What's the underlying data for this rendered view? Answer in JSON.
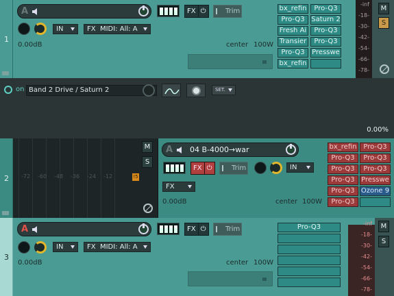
{
  "colors": {
    "track_bg": "#4a9b93",
    "meter_bg": "#221c1c",
    "fx_teal": "#2e8a84",
    "fx_red": "#9b3a3a",
    "accent_yellow": "#e2b72b",
    "envelope_bg": "#2c3536"
  },
  "track1": {
    "number": "1",
    "input": "IN",
    "fx_label": "FX",
    "midi_input": "MIDI: All: A",
    "volume": "0.00dB",
    "pan": "center",
    "width": "100W",
    "fx_button": "FX",
    "trim_label": "Trim",
    "plugins": [
      "bx_refin",
      "Pro-Q3",
      "Pro-Q3",
      "Saturn 2",
      "Fresh Ai",
      "Pro-Q3",
      "Transier",
      "Pro-Q3",
      "Pro-Q3",
      "Presswe",
      "bx_refin",
      ""
    ],
    "meter_labels": [
      "-inf",
      "-18-",
      "-30-",
      "-42-",
      "-54-",
      "-66-",
      "-78-"
    ],
    "mute": "M",
    "solo": "S"
  },
  "envelope": {
    "toggle_label": "on",
    "name": "Band 2 Drive / Saturn 2",
    "set_label": "SET.",
    "value": "0.00%"
  },
  "track2": {
    "number": "2",
    "name": "04 B-4000→war",
    "input": "IN",
    "fx_label": "FX",
    "volume": "0.00dB",
    "pan": "center",
    "width": "100W",
    "fx_button": "FX",
    "trim_label": "Trim",
    "plugins": [
      "bx_refin",
      "Pro-Q3",
      "Pro-Q3",
      "Pro-Q3",
      "Pro-Q3",
      "Pro-Q3",
      "Pro-Q3",
      "Presswe",
      "Pro-Q3",
      "Ozone 9",
      "Pro-Q3",
      ""
    ],
    "meter_labels": [
      "-72",
      "-60",
      "-48",
      "-36",
      "-24",
      "-12"
    ],
    "clip_label": "!5",
    "mute": "M",
    "solo": "S"
  },
  "track3": {
    "number": "3",
    "input": "IN",
    "fx_label": "FX",
    "midi_input": "MIDI: All: A",
    "volume": "0.00dB",
    "pan": "center",
    "width": "100W",
    "fx_button": "FX",
    "trim_label": "Trim",
    "plugins": [
      "Pro-Q3",
      "",
      "",
      "",
      "",
      ""
    ],
    "meter_labels": [
      "-inf",
      "-18-",
      "-30-",
      "-42-",
      "-54-",
      "-66-",
      "-78-"
    ],
    "mute": "M",
    "solo": "S"
  }
}
